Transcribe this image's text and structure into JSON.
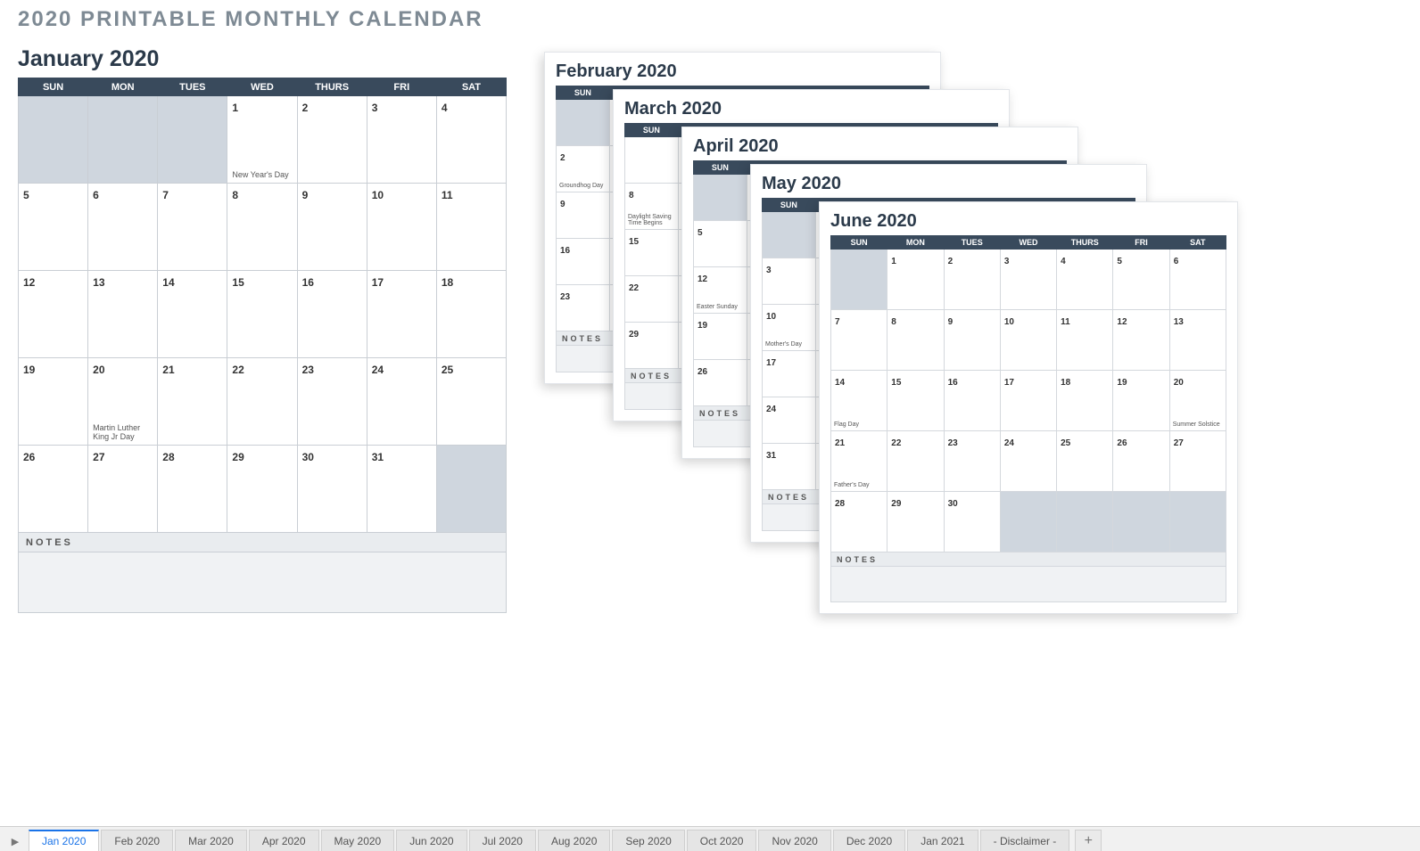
{
  "page_title": "2020 PRINTABLE MONTHLY CALENDAR",
  "day_headers": [
    "SUN",
    "MON",
    "TUES",
    "WED",
    "THURS",
    "FRI",
    "SAT"
  ],
  "notes_label": "NOTES",
  "main": {
    "title": "January 2020",
    "weeks": [
      [
        {
          "inactive": true
        },
        {
          "inactive": true
        },
        {
          "inactive": true
        },
        {
          "d": "1",
          "event": "New Year's Day"
        },
        {
          "d": "2"
        },
        {
          "d": "3"
        },
        {
          "d": "4"
        }
      ],
      [
        {
          "d": "5"
        },
        {
          "d": "6"
        },
        {
          "d": "7"
        },
        {
          "d": "8"
        },
        {
          "d": "9"
        },
        {
          "d": "10"
        },
        {
          "d": "11"
        }
      ],
      [
        {
          "d": "12"
        },
        {
          "d": "13"
        },
        {
          "d": "14"
        },
        {
          "d": "15"
        },
        {
          "d": "16"
        },
        {
          "d": "17"
        },
        {
          "d": "18"
        }
      ],
      [
        {
          "d": "19"
        },
        {
          "d": "20",
          "event": "Martin Luther King Jr Day"
        },
        {
          "d": "21"
        },
        {
          "d": "22"
        },
        {
          "d": "23"
        },
        {
          "d": "24"
        },
        {
          "d": "25"
        }
      ],
      [
        {
          "d": "26"
        },
        {
          "d": "27"
        },
        {
          "d": "28"
        },
        {
          "d": "29"
        },
        {
          "d": "30"
        },
        {
          "d": "31"
        },
        {
          "inactive": true
        }
      ]
    ]
  },
  "june": {
    "title": "June 2020",
    "weeks": [
      [
        {
          "inactive": true
        },
        {
          "d": "1"
        },
        {
          "d": "2"
        },
        {
          "d": "3"
        },
        {
          "d": "4"
        },
        {
          "d": "5"
        },
        {
          "d": "6"
        }
      ],
      [
        {
          "d": "7"
        },
        {
          "d": "8"
        },
        {
          "d": "9"
        },
        {
          "d": "10"
        },
        {
          "d": "11"
        },
        {
          "d": "12"
        },
        {
          "d": "13"
        }
      ],
      [
        {
          "d": "14",
          "event": "Flag Day"
        },
        {
          "d": "15"
        },
        {
          "d": "16"
        },
        {
          "d": "17"
        },
        {
          "d": "18"
        },
        {
          "d": "19"
        },
        {
          "d": "20",
          "event": "Summer Solstice"
        }
      ],
      [
        {
          "d": "21",
          "event": "Father's Day"
        },
        {
          "d": "22"
        },
        {
          "d": "23"
        },
        {
          "d": "24"
        },
        {
          "d": "25"
        },
        {
          "d": "26"
        },
        {
          "d": "27"
        }
      ],
      [
        {
          "d": "28"
        },
        {
          "d": "29"
        },
        {
          "d": "30"
        },
        {
          "inactive": true
        },
        {
          "inactive": true
        },
        {
          "inactive": true
        },
        {
          "inactive": true
        }
      ]
    ]
  },
  "feb": {
    "title": "February 2020",
    "col": [
      {
        "inactive": true
      },
      {
        "d": "2",
        "event": "Groundhog Day"
      },
      {
        "d": "9"
      },
      {
        "d": "16"
      },
      {
        "d": "23"
      }
    ]
  },
  "mar": {
    "title": "March 2020",
    "col": [
      {
        "d": ""
      },
      {
        "d": "8",
        "event": "Daylight Saving Time Begins"
      },
      {
        "d": "15"
      },
      {
        "d": "22"
      },
      {
        "d": "29"
      }
    ]
  },
  "apr": {
    "title": "April 2020",
    "col": [
      {
        "inactive": true
      },
      {
        "d": "5"
      },
      {
        "d": "12",
        "event": "Easter Sunday"
      },
      {
        "d": "19"
      },
      {
        "d": "26"
      }
    ]
  },
  "may": {
    "title": "May 2020",
    "col": [
      {
        "inactive": true
      },
      {
        "d": "3"
      },
      {
        "d": "10",
        "event": "Mother's Day"
      },
      {
        "d": "17"
      },
      {
        "d": "24"
      },
      {
        "d": "31"
      }
    ]
  },
  "tabs": {
    "items": [
      "Jan 2020",
      "Feb 2020",
      "Mar 2020",
      "Apr 2020",
      "May 2020",
      "Jun 2020",
      "Jul 2020",
      "Aug 2020",
      "Sep 2020",
      "Oct 2020",
      "Nov 2020",
      "Dec 2020",
      "Jan 2021",
      "- Disclaimer -"
    ],
    "active_index": 0,
    "add": "+"
  }
}
